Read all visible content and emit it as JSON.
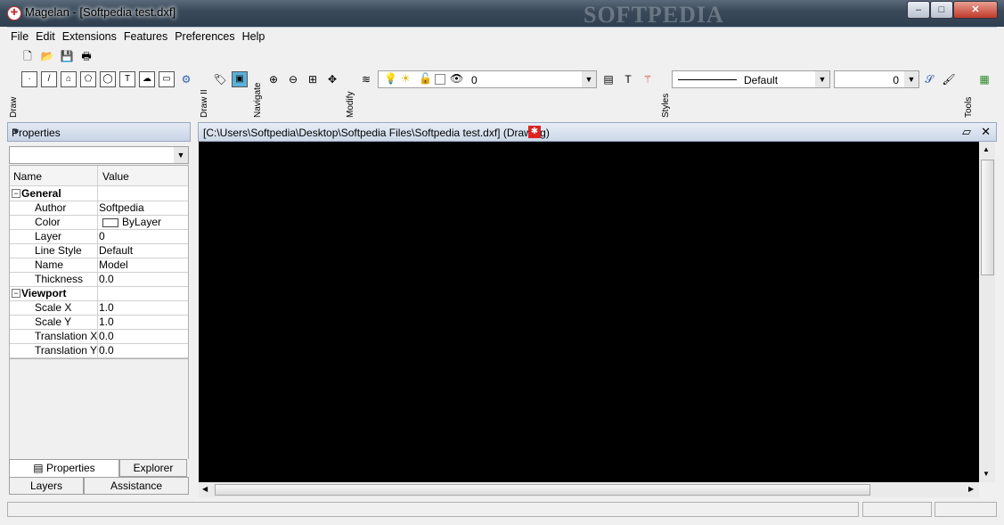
{
  "window": {
    "title": "Magelan - [Softpedia test.dxf]",
    "watermark": "SOFTPEDIA",
    "min_glyph": "–",
    "max_glyph": "□",
    "close_glyph": "✕"
  },
  "menu": [
    "File",
    "Edit",
    "Extensions",
    "Features",
    "Preferences",
    "Help"
  ],
  "toolbar_labels": {
    "draw": "Draw",
    "draw2": "Draw II",
    "navigate": "Navigate",
    "modify": "Modify",
    "styles": "Styles",
    "tools": "Tools"
  },
  "toolbar": {
    "layer_value": "0",
    "linestyle_value": "Default",
    "lineweight_value": "0"
  },
  "panel": {
    "title": "Properties",
    "columns": [
      "Name",
      "Value"
    ],
    "categories": [
      {
        "name": "General",
        "rows": [
          {
            "name": "Author",
            "value": "Softpedia"
          },
          {
            "name": "Color",
            "value": "ByLayer"
          },
          {
            "name": "Layer",
            "value": "0"
          },
          {
            "name": "Line Style",
            "value": "Default"
          },
          {
            "name": "Name",
            "value": "Model"
          },
          {
            "name": "Thickness",
            "value": "0.0"
          }
        ]
      },
      {
        "name": "Viewport",
        "rows": [
          {
            "name": "Scale X",
            "value": "1.0"
          },
          {
            "name": "Scale Y",
            "value": "1.0"
          },
          {
            "name": "Translation X",
            "value": "0.0"
          },
          {
            "name": "Translation Y",
            "value": "0.0"
          }
        ]
      }
    ],
    "tabs_top": [
      "Properties",
      "Explorer"
    ],
    "tabs_bottom": [
      "Layers",
      "Assistance"
    ]
  },
  "document": {
    "path": "[C:\\Users\\Softpedia\\Desktop\\Softpedia Files\\Softpedia test.dxf] (Drawing)",
    "background": "#000000"
  }
}
